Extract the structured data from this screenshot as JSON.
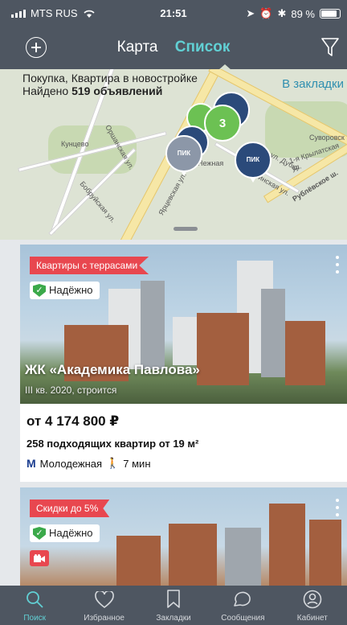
{
  "status_bar": {
    "carrier": "MTS RUS",
    "time": "21:51",
    "battery": "89 %"
  },
  "header": {
    "tab_map": "Карта",
    "tab_list": "Список",
    "active_tab": "Список"
  },
  "map": {
    "search_summary": "Покупка, Квартира в новостройке",
    "found_prefix": "Найдено ",
    "found_count": "519 объявлений",
    "bookmark_link": "В закладки",
    "cluster_count": "3",
    "district": "Кунцево",
    "streets": [
      "Оршанская ул.",
      "Ярцевская ул.",
      "Бобруйская ул.",
      "Рублёвское ш.",
      "Ельнинская ул.",
      "Суворовск",
      "1-я Крылатская ул.",
      "Нежная",
      "ул. Дубки"
    ],
    "pin_logo": "ПИК"
  },
  "listings": [
    {
      "promo_tag": "Квартиры с террасами",
      "badge": "Надёжно",
      "title": "ЖК «Академика Павлова»",
      "subtitle": "III кв. 2020, строится",
      "price": "от 4 174 800 ₽",
      "flats": "258 подходящих квартир от 19 м²",
      "metro_station": "Молодежная",
      "walk_time": "7 мин"
    },
    {
      "promo_tag": "Скидки до 5%",
      "badge": "Надёжно"
    }
  ],
  "tabbar": [
    {
      "label": "Поиск",
      "icon": "search-icon",
      "active": true
    },
    {
      "label": "Избранное",
      "icon": "heart-icon",
      "active": false
    },
    {
      "label": "Закладки",
      "icon": "bookmark-icon",
      "active": false
    },
    {
      "label": "Сообщения",
      "icon": "chat-icon",
      "active": false
    },
    {
      "label": "Кабинет",
      "icon": "user-icon",
      "active": false
    }
  ],
  "colors": {
    "header_bg": "#4e5661",
    "accent": "#61d0d4",
    "promo_red": "#e8474f",
    "safe_green": "#3ba94a"
  }
}
